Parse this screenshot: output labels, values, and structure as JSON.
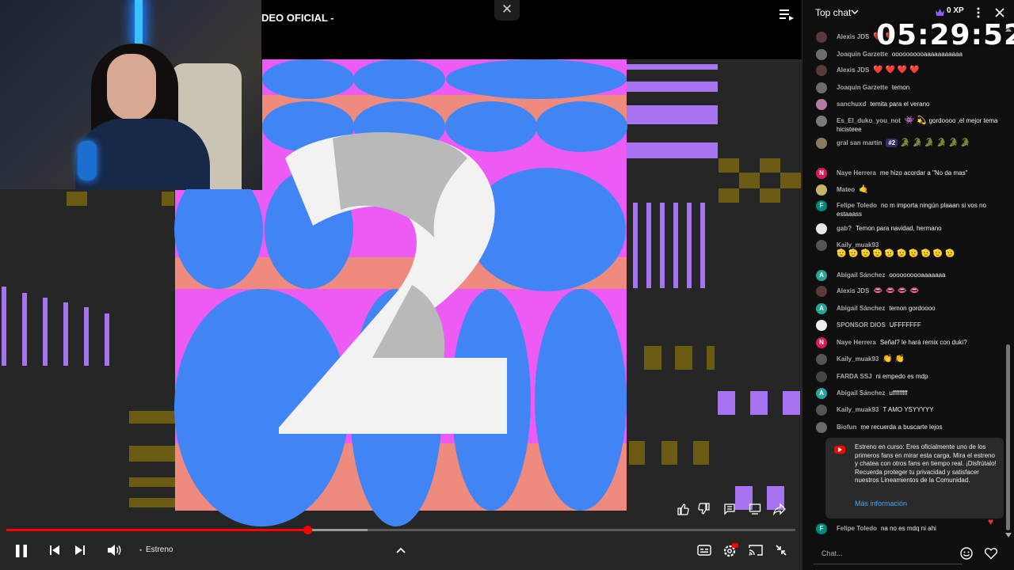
{
  "video": {
    "title": "DEO OFICIAL -",
    "overlay_close": "✕",
    "live_label": "Estreno",
    "progress": {
      "played_fraction": 0.382,
      "buffered_fraction": 0.458
    }
  },
  "timer": "05:29:52",
  "chat": {
    "mode_label": "Top chat",
    "xp_label": "0 XP",
    "input_placeholder": "Chat...",
    "messages": [
      {
        "author": "Alexis JDS",
        "text": "",
        "emoji": "❤️ ❤️",
        "avatar_color": "#5a3b3b",
        "avatar_letter": ""
      },
      {
        "author": "Joaquin Garzette",
        "text": "oooooooooaaaaaaaaaaa",
        "emoji": "",
        "avatar_color": "#6d6d6d",
        "avatar_letter": ""
      },
      {
        "author": "Alexis JDS",
        "text": "",
        "emoji": "❤️ ❤️ ❤️ ❤️",
        "avatar_color": "#5a3b3b",
        "avatar_letter": ""
      },
      {
        "author": "Joaquin Garzette",
        "text": "temon",
        "emoji": "",
        "avatar_color": "#6d6d6d",
        "avatar_letter": ""
      },
      {
        "author": "sanchuxd",
        "text": "temita para el verano",
        "emoji": "",
        "avatar_color": "#b77aa8",
        "avatar_letter": ""
      },
      {
        "author": "Es_El_duko_you_not",
        "text": "gordoooo ,el mejor tema hicisteee",
        "emoji": "👾 💫",
        "avatar_color": "#7a7a7a",
        "avatar_letter": ""
      },
      {
        "author": "gral san martin",
        "text": "",
        "badge": "#2",
        "emoji": "🐊 🐊 🐊 🐊 🐊 🐊",
        "avatar_color": "#8a7a60",
        "avatar_letter": ""
      },
      {
        "author": "Naye Herrera",
        "text": "me hizo acordar a \"No da mas\"",
        "emoji": "",
        "avatar_color": "#d81b60",
        "avatar_letter": "N"
      },
      {
        "author": "Mateo",
        "text": "",
        "emoji": "🤙",
        "avatar_color": "#c9b26a",
        "avatar_letter": ""
      },
      {
        "author": "Felipe Toledo",
        "text": "no m importa ningún plaaan si vos no estaaass",
        "emoji": "",
        "avatar_color": "#00897b",
        "avatar_letter": "F"
      },
      {
        "author": "gab?",
        "text": "Temon para navidad, hermano",
        "emoji": "",
        "avatar_color": "#e8e8e8",
        "avatar_letter": ""
      },
      {
        "author": "Kaily_muak93",
        "text": "",
        "emoji": "🫡 🫡 🫡 🫡 🫡 🫡 🫡 🫡 🫡 🫡",
        "avatar_color": "#555555",
        "avatar_letter": ""
      },
      {
        "author": "Abigail Sánchez",
        "text": "oooooooooaaaaaaa",
        "emoji": "",
        "avatar_color": "#26a69a",
        "avatar_letter": "A"
      },
      {
        "author": "Alexis JDS",
        "text": "",
        "emoji": "👄 👄 👄 👄",
        "avatar_color": "#5a3b3b",
        "avatar_letter": ""
      },
      {
        "author": "Abigail Sánchez",
        "text": "temon gordoooo",
        "emoji": "",
        "avatar_color": "#26a69a",
        "avatar_letter": "A"
      },
      {
        "author": "SPONSOR DIOS",
        "text": "UFFFFFFF",
        "emoji": "",
        "avatar_color": "#eeeeee",
        "avatar_letter": ""
      },
      {
        "author": "Naye Herrera",
        "text": "Señal? le hará remix con duki?",
        "emoji": "",
        "avatar_color": "#d81b60",
        "avatar_letter": "N"
      },
      {
        "author": "Kaily_muak93",
        "text": "",
        "emoji": "👏 👏",
        "avatar_color": "#555555",
        "avatar_letter": ""
      },
      {
        "author": "FARDA SSJ",
        "text": "ni empedo es mdp",
        "emoji": "",
        "avatar_color": "#444444",
        "avatar_letter": ""
      },
      {
        "author": "Abigail Sánchez",
        "text": "ufffffffff",
        "emoji": "",
        "avatar_color": "#26a69a",
        "avatar_letter": "A"
      },
      {
        "author": "Kaily_muak93",
        "text": "T AMO YSYYYYY",
        "emoji": "",
        "avatar_color": "#555555",
        "avatar_letter": ""
      },
      {
        "author": "Biofun",
        "text": "me recuerda a buscarte lejos",
        "emoji": "",
        "avatar_color": "#6a6a6a",
        "avatar_letter": ""
      },
      {
        "author": "Felipe Toledo",
        "text": "na no es mdq ni ahi",
        "emoji": "",
        "avatar_color": "#00897b",
        "avatar_letter": "F"
      }
    ],
    "notice": {
      "text": "Estreno en curso: Eres oficialmente uno de los primeros fans en mirar esta carga. Mira el estreno y chatea con otros fans en tiempo real. ¡Disfrútalo! Recuerda proteger tu privacidad y satisfacer nuestros Lineamientos de la Comunidad.",
      "link": "Más información"
    }
  },
  "colors": {
    "accent_red": "#ff0000",
    "link_blue": "#3ea6ff",
    "art_blue": "#4185f4",
    "art_pink": "#ec5cf5",
    "art_salmon": "#ef8b7e",
    "art_purple": "#a873f0",
    "art_gold": "#6b5b13"
  },
  "icons": [
    "close-icon",
    "queue-icon",
    "pause-icon",
    "previous-icon",
    "next-icon",
    "volume-icon",
    "chevron-up-icon",
    "captions-icon",
    "settings-icon",
    "cast-icon",
    "exit-fullscreen-icon",
    "like-icon",
    "dislike-icon",
    "comment-icon",
    "chat-icon",
    "share-icon",
    "chevron-down-icon",
    "kebab-icon",
    "emoji-icon",
    "heart-icon",
    "crown-icon"
  ]
}
